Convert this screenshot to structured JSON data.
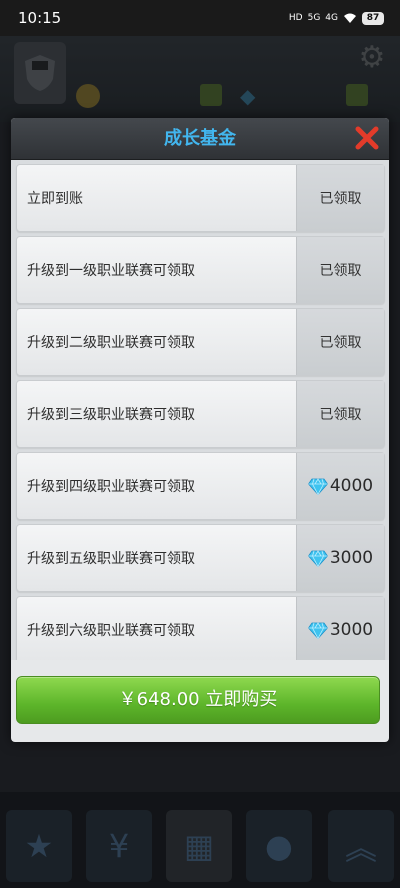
{
  "status_bar": {
    "time": "10:15",
    "indicators": [
      "HD",
      "5G",
      "4G"
    ],
    "battery": "87",
    "icons": [
      "wifi-icon",
      "battery-icon"
    ]
  },
  "modal": {
    "title": "成长基金",
    "close_icon": "close-x-icon",
    "title_color": "#42b6ee",
    "close_color": "#e33b2a",
    "rows": [
      {
        "label": "立即到账",
        "status": "已领取",
        "claimed": true
      },
      {
        "label": "升级到一级职业联赛可领取",
        "status": "已领取",
        "claimed": true
      },
      {
        "label": "升级到二级职业联赛可领取",
        "status": "已领取",
        "claimed": true
      },
      {
        "label": "升级到三级职业联赛可领取",
        "status": "已领取",
        "claimed": true
      },
      {
        "label": "升级到四级职业联赛可领取",
        "status": "4000",
        "claimed": false,
        "icon": "diamond-icon"
      },
      {
        "label": "升级到五级职业联赛可领取",
        "status": "3000",
        "claimed": false,
        "icon": "diamond-icon"
      },
      {
        "label": "升级到六级职业联赛可领取",
        "status": "3000",
        "claimed": false,
        "icon": "diamond-icon"
      }
    ],
    "buy_button": {
      "label": "￥648.00 立即购买",
      "color": "#5db52a"
    }
  }
}
